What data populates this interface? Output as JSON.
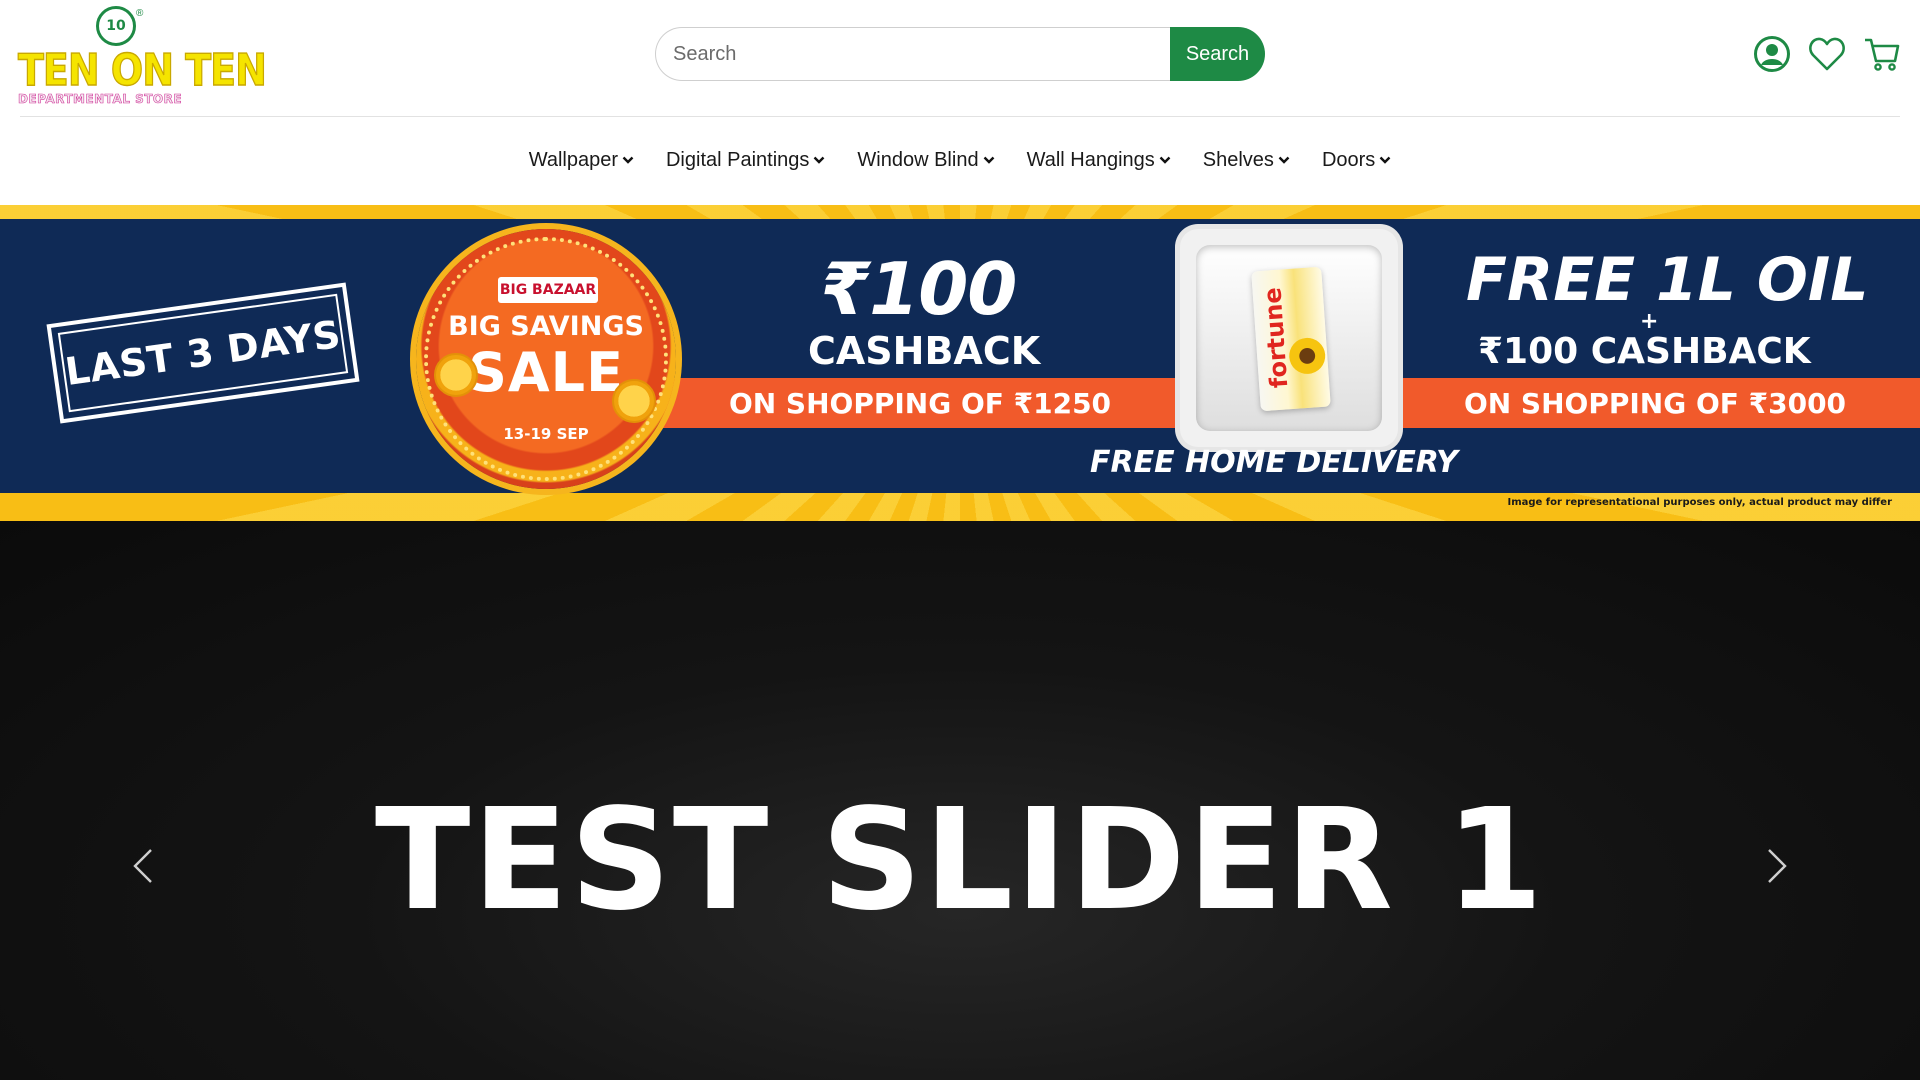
{
  "brand": {
    "name": "TEN ON TEN",
    "subtitle": "DEPARTMENTAL STORE",
    "badge": "10",
    "reg": "®"
  },
  "search": {
    "placeholder": "Search",
    "button_label": "Search"
  },
  "header_icons": [
    "user-account-icon",
    "wishlist-heart-icon",
    "cart-icon"
  ],
  "nav": {
    "items": [
      {
        "label": "Wallpaper"
      },
      {
        "label": "Digital Paintings"
      },
      {
        "label": "Window Blind"
      },
      {
        "label": "Wall Hangings"
      },
      {
        "label": "Shelves"
      },
      {
        "label": "Doors"
      }
    ]
  },
  "promo": {
    "last_days": "LAST 3 DAYS",
    "store_tag": "BIG BAZAAR",
    "sale_line1": "BIG SAVINGS",
    "sale_line2": "SALE",
    "sale_dates": "13-19 SEP",
    "cashback_amount": "₹100",
    "cashback_label": "CASHBACK",
    "cashback_condition": "ON SHOPPING OF ₹1250",
    "product_brand": "fortune",
    "offer2_title": "FREE 1L OIL",
    "offer2_plus": "+",
    "offer2_cashback": "₹100 CASHBACK",
    "offer2_condition": "ON SHOPPING OF ₹3000",
    "delivery": "FREE HOME DELIVERY",
    "disclaimer": "Image for representational purposes only, actual product may differ"
  },
  "hero": {
    "title": "TEST SLIDER 1"
  },
  "colors": {
    "brand_green": "#1e8a45",
    "navy": "#0f2a56",
    "promo_orange": "#f15a2b",
    "promo_yellow": "#f9c31e"
  }
}
